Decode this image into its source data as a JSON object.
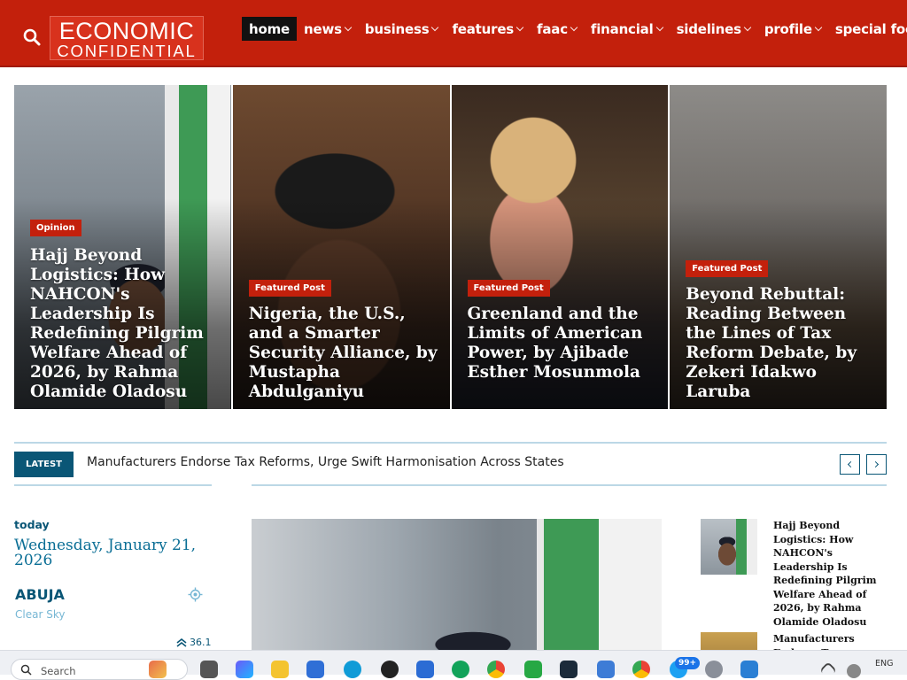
{
  "header": {
    "logo_line1": "ECONOMIC",
    "logo_line2": "CONFIDENTIAL",
    "nav": [
      {
        "label": "home",
        "active": true,
        "dropdown": false
      },
      {
        "label": "news",
        "active": false,
        "dropdown": true
      },
      {
        "label": "business",
        "active": false,
        "dropdown": true
      },
      {
        "label": "features",
        "active": false,
        "dropdown": true
      },
      {
        "label": "faac",
        "active": false,
        "dropdown": true
      },
      {
        "label": "financial",
        "active": false,
        "dropdown": true
      },
      {
        "label": "sidelines",
        "active": false,
        "dropdown": true
      },
      {
        "label": "profile",
        "active": false,
        "dropdown": true
      },
      {
        "label": "special focus",
        "active": false,
        "dropdown": true
      }
    ]
  },
  "hero": {
    "cards": [
      {
        "badge": "Opinion",
        "title": "Hajj Beyond Logistics: How NAHCON's Leadership Is Redefining Pilgrim Welfare Ahead of 2026, by Rahma Olamide Oladosu"
      },
      {
        "badge": "Featured Post",
        "title": "Nigeria, the U.S., and a Smarter Security Alliance, by Mustapha Abdulganiyu"
      },
      {
        "badge": "Featured Post",
        "title": "Greenland and the Limits of American Power, by Ajibade Esther Mosunmola"
      },
      {
        "badge": "Featured Post",
        "title": "Beyond Rebuttal: Reading Between the Lines of Tax Reform Debate, by Zekeri Idakwo Laruba"
      }
    ]
  },
  "ticker": {
    "label": "LATEST",
    "headline": "Manufacturers Endorse Tax Reforms, Urge Swift Harmonisation Across States"
  },
  "weather": {
    "today_label": "today",
    "date": "Wednesday, January 21, 2026",
    "city": "ABUJA",
    "condition": "Clear Sky",
    "wind": "36.1"
  },
  "sidebar": {
    "items": [
      {
        "title": "Hajj Beyond Logistics: How NAHCON's Leadership Is Redefining Pilgrim Welfare Ahead of 2026, by Rahma Olamide Oladosu"
      },
      {
        "title": "Manufacturers Endorse Tax Reforms, Urge..."
      }
    ]
  },
  "taskbar": {
    "search_placeholder": "Search",
    "badge": "99+",
    "lang": "ENG"
  },
  "colors": {
    "brand_red": "#c3200c",
    "accent_blue": "#0a5676"
  }
}
